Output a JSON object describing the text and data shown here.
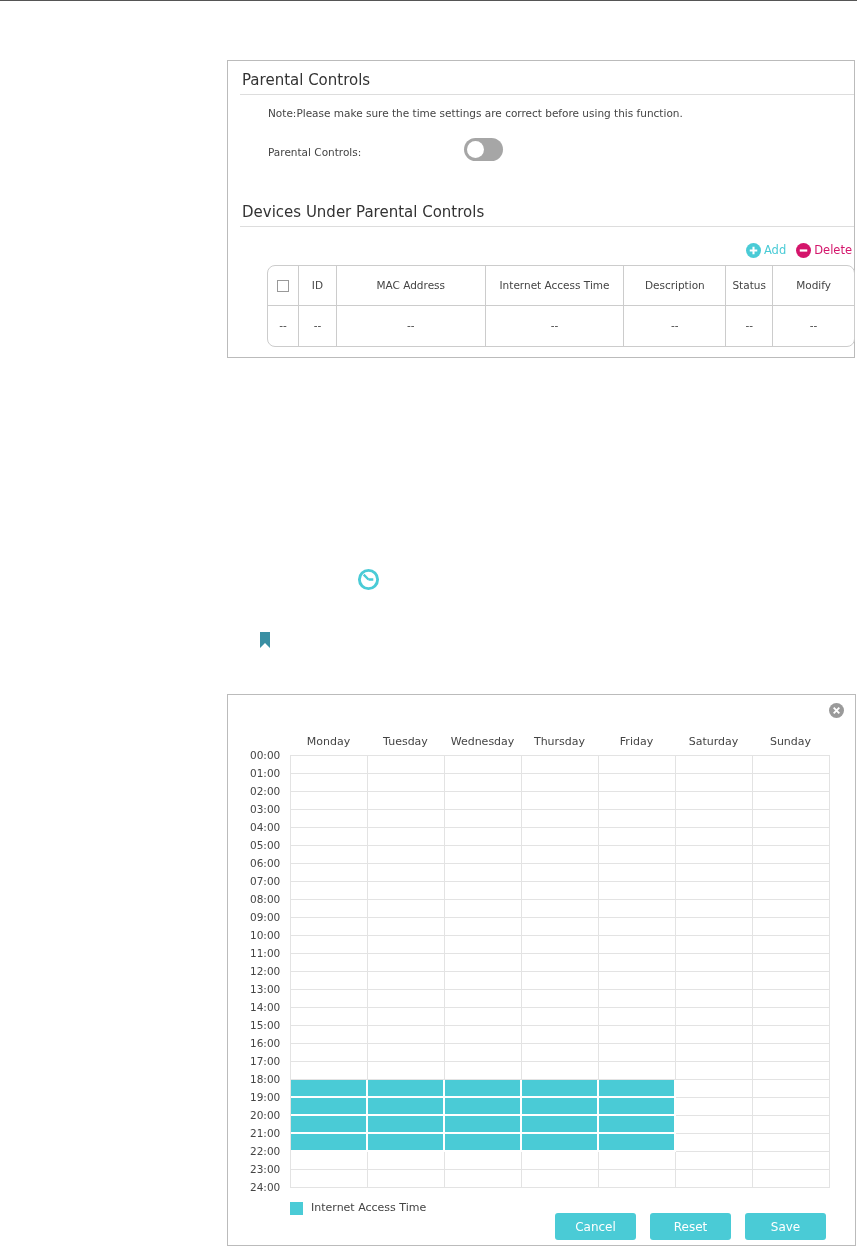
{
  "settings_panel": {
    "title": "Parental Controls",
    "note": "Note:Please make sure the time settings are correct before using this function.",
    "toggle": {
      "label": "Parental Controls:",
      "on": false
    }
  },
  "devices": {
    "title": "Devices Under Parental Controls",
    "actions": [
      {
        "kind": "add",
        "label": "Add"
      },
      {
        "kind": "delete",
        "label": "Delete"
      }
    ],
    "table": {
      "columns": [
        {
          "kind": "checkbox",
          "checked": false
        },
        {
          "kind": "text",
          "label": "ID"
        },
        {
          "kind": "text",
          "label": "MAC Address"
        },
        {
          "kind": "text",
          "label": "Internet Access Time"
        },
        {
          "kind": "text",
          "label": "Description"
        },
        {
          "kind": "text",
          "label": "Status"
        },
        {
          "kind": "text",
          "label": "Modify"
        }
      ],
      "rows": [
        [
          "--",
          "--",
          "--",
          "--",
          "--",
          "--",
          "--"
        ]
      ]
    }
  },
  "schedule": {
    "days": [
      {
        "label": "Monday",
        "slots": [
          false,
          false,
          false,
          false,
          false,
          false,
          false,
          false,
          false,
          false,
          false,
          false,
          false,
          false,
          false,
          false,
          false,
          false,
          true,
          true,
          true,
          true,
          false,
          false
        ]
      },
      {
        "label": "Tuesday",
        "slots": [
          false,
          false,
          false,
          false,
          false,
          false,
          false,
          false,
          false,
          false,
          false,
          false,
          false,
          false,
          false,
          false,
          false,
          false,
          true,
          true,
          true,
          true,
          false,
          false
        ]
      },
      {
        "label": "Wednesday",
        "slots": [
          false,
          false,
          false,
          false,
          false,
          false,
          false,
          false,
          false,
          false,
          false,
          false,
          false,
          false,
          false,
          false,
          false,
          false,
          true,
          true,
          true,
          true,
          false,
          false
        ]
      },
      {
        "label": "Thursday",
        "slots": [
          false,
          false,
          false,
          false,
          false,
          false,
          false,
          false,
          false,
          false,
          false,
          false,
          false,
          false,
          false,
          false,
          false,
          false,
          true,
          true,
          true,
          true,
          false,
          false
        ]
      },
      {
        "label": "Friday",
        "slots": [
          false,
          false,
          false,
          false,
          false,
          false,
          false,
          false,
          false,
          false,
          false,
          false,
          false,
          false,
          false,
          false,
          false,
          false,
          true,
          true,
          true,
          true,
          false,
          false
        ]
      },
      {
        "label": "Saturday",
        "slots": [
          false,
          false,
          false,
          false,
          false,
          false,
          false,
          false,
          false,
          false,
          false,
          false,
          false,
          false,
          false,
          false,
          false,
          false,
          false,
          false,
          false,
          false,
          false,
          false
        ]
      },
      {
        "label": "Sunday",
        "slots": [
          false,
          false,
          false,
          false,
          false,
          false,
          false,
          false,
          false,
          false,
          false,
          false,
          false,
          false,
          false,
          false,
          false,
          false,
          false,
          false,
          false,
          false,
          false,
          false
        ]
      }
    ],
    "hours": [
      "00:00",
      "01:00",
      "02:00",
      "03:00",
      "04:00",
      "05:00",
      "06:00",
      "07:00",
      "08:00",
      "09:00",
      "10:00",
      "11:00",
      "12:00",
      "13:00",
      "14:00",
      "15:00",
      "16:00",
      "17:00",
      "18:00",
      "19:00",
      "20:00",
      "21:00",
      "22:00",
      "23:00",
      "24:00"
    ],
    "legend": "Internet Access Time",
    "buttons": [
      "Cancel",
      "Reset",
      "Save"
    ]
  }
}
